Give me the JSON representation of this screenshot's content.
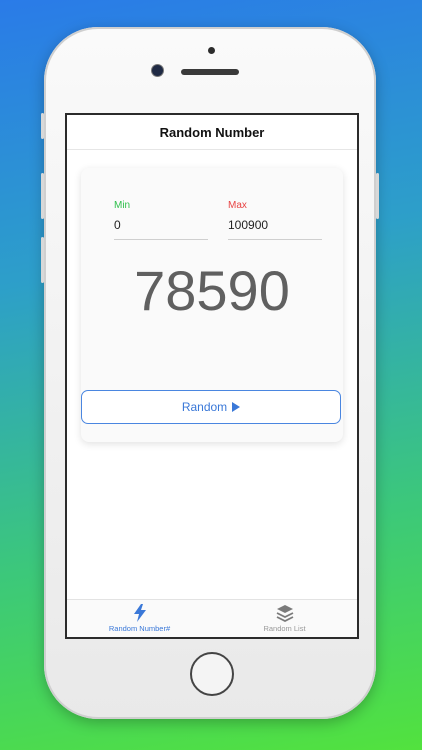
{
  "screen": {
    "title": "Random Number"
  },
  "range": {
    "min_label": "Min",
    "min_value": "0",
    "max_label": "Max",
    "max_value": "100900"
  },
  "result": "78590",
  "action": {
    "label": "Random",
    "icon": "play-icon"
  },
  "tabs": [
    {
      "label": "Random Number#",
      "icon": "lightning-icon",
      "active": true
    },
    {
      "label": "Random List",
      "icon": "layers-icon",
      "active": false
    }
  ],
  "colors": {
    "accent": "#3a78d8",
    "min_label": "#2fc04c",
    "max_label": "#e84343",
    "result_text": "#606060"
  }
}
